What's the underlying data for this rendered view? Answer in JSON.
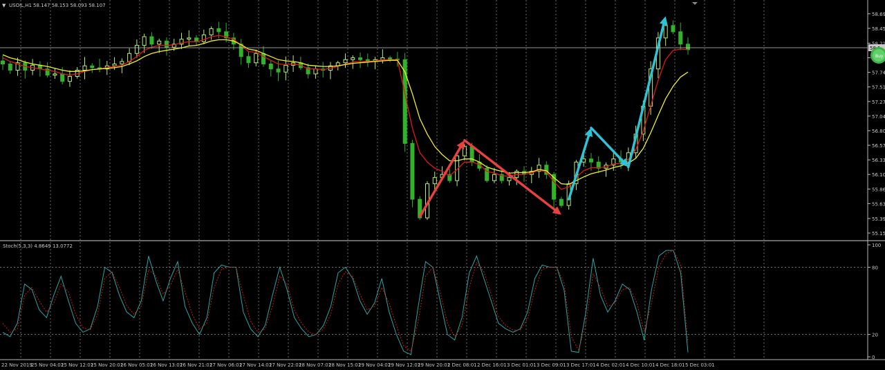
{
  "header": {
    "symbol_label": "USOIL,H1",
    "ohlc_label": "58.147 58.153 58.093 58.107",
    "scroll_marker": "▼"
  },
  "price_panel": {
    "current_price_label": "58.1",
    "buy_badge_label": "Buy"
  },
  "indicator_panel": {
    "label": "Stoch(5,3,3) 4.8649 13.0772",
    "levels": [
      80,
      20
    ],
    "scale_labels": [
      "100",
      "80",
      "20",
      "0"
    ]
  },
  "colors": {
    "background": "#000000",
    "bull_candle": "#b7f07a",
    "bear_candle": "#31b22a",
    "ma_red": "#e01818",
    "ma_yellow": "#f2ee2a",
    "stoch_main": "#2aa6a6",
    "stoch_signal": "#d01818",
    "arrow_red": "#e8413f",
    "arrow_cyan": "#2ec4d6",
    "grid": "#9a9a9a"
  },
  "chart_data": [
    {
      "type": "candlestick",
      "title": "USOIL,H1",
      "ylim": [
        55.155,
        58.8
      ],
      "y_ticks": [
        "58.690",
        "58.455",
        "58.215",
        "57.980",
        "57.745",
        "57.510",
        "57.275",
        "57.040",
        "56.805",
        "56.570",
        "56.335",
        "56.100",
        "55.865",
        "55.630",
        "55.390",
        "55.155"
      ],
      "x_tick_labels": [
        "22 Nov 2019",
        "25 Nov 04:01",
        "25 Nov 12:01",
        "25 Nov 20:01",
        "26 Nov 05:01",
        "26 Nov 13:01",
        "26 Nov 21:01",
        "27 Nov 06:01",
        "27 Nov 14:01",
        "27 Nov 22:01",
        "28 Nov 07:01",
        "28 Nov 15:01",
        "29 Nov 04:01",
        "29 Nov 12:01",
        "29 Nov 20:01",
        "2 Dec 08:01",
        "2 Dec 16:01",
        "3 Dec 01:01",
        "3 Dec 09:01",
        "3 Dec 17:01",
        "4 Dec 02:01",
        "4 Dec 10:01",
        "4 Dec 18:01",
        "5 Dec 03:01"
      ],
      "close_path": [
        57.88,
        57.78,
        57.9,
        57.78,
        57.86,
        57.8,
        57.7,
        57.72,
        57.6,
        57.68,
        57.78,
        57.85,
        57.82,
        57.8,
        57.85,
        57.88,
        57.92,
        58.05,
        58.18,
        58.32,
        58.2,
        58.25,
        58.15,
        58.2,
        58.28,
        58.3,
        58.24,
        58.35,
        58.45,
        58.4,
        58.3,
        58.2,
        58.0,
        57.9,
        58.05,
        57.88,
        57.8,
        57.75,
        57.86,
        57.9,
        57.82,
        57.72,
        57.8,
        57.78,
        57.85,
        57.9,
        57.95,
        57.98,
        57.95,
        57.92,
        57.95,
        57.98,
        57.96,
        57.95,
        56.6,
        55.7,
        55.4,
        55.95,
        56.05,
        56.1,
        56.0,
        56.4,
        56.55,
        56.3,
        56.2,
        56.0,
        56.1,
        56.0,
        56.05,
        56.15,
        56.1,
        56.15,
        56.25,
        56.1,
        55.7,
        55.6,
        55.95,
        56.3,
        56.35,
        56.3,
        56.2,
        56.25,
        56.35,
        56.3,
        56.45,
        56.75,
        57.2,
        57.8,
        58.3,
        58.5,
        58.4,
        58.2,
        58.11
      ],
      "series": [
        {
          "name": "MA red",
          "color": "#e01818",
          "values": [
            57.98,
            57.92,
            57.88,
            57.84,
            57.82,
            57.8,
            57.78,
            57.76,
            57.72,
            57.7,
            57.72,
            57.76,
            57.79,
            57.8,
            57.82,
            57.84,
            57.86,
            57.92,
            58.0,
            58.1,
            58.15,
            58.18,
            58.18,
            58.19,
            58.22,
            58.24,
            58.24,
            58.27,
            58.32,
            58.34,
            58.32,
            58.28,
            58.18,
            58.08,
            58.07,
            58.0,
            57.94,
            57.88,
            57.87,
            57.88,
            57.86,
            57.8,
            57.8,
            57.79,
            57.81,
            57.84,
            57.88,
            57.91,
            57.92,
            57.92,
            57.93,
            57.95,
            57.95,
            57.95,
            57.4,
            56.85,
            56.45,
            56.3,
            56.2,
            56.15,
            56.08,
            56.18,
            56.3,
            56.3,
            56.26,
            56.15,
            56.12,
            56.08,
            56.07,
            56.1,
            56.1,
            56.12,
            56.17,
            56.14,
            55.98,
            55.86,
            55.9,
            56.05,
            56.16,
            56.21,
            56.21,
            56.22,
            56.27,
            56.28,
            56.34,
            56.5,
            56.8,
            57.2,
            57.62,
            57.95,
            58.1,
            58.12,
            58.11
          ]
        },
        {
          "name": "MA yellow",
          "color": "#f2ee2a",
          "values": [
            58.03,
            57.98,
            57.95,
            57.91,
            57.88,
            57.86,
            57.84,
            57.81,
            57.78,
            57.76,
            57.76,
            57.77,
            57.79,
            57.8,
            57.81,
            57.82,
            57.84,
            57.88,
            57.93,
            58.0,
            58.05,
            58.08,
            58.1,
            58.12,
            58.14,
            58.17,
            58.18,
            58.21,
            58.25,
            58.27,
            58.27,
            58.25,
            58.19,
            58.12,
            58.1,
            58.05,
            58.0,
            57.95,
            57.93,
            57.92,
            57.9,
            57.86,
            57.85,
            57.84,
            57.84,
            57.85,
            57.87,
            57.89,
            57.9,
            57.91,
            57.92,
            57.93,
            57.94,
            57.94,
            57.75,
            57.4,
            57.0,
            56.75,
            56.55,
            56.42,
            56.32,
            56.32,
            56.35,
            56.35,
            56.3,
            56.22,
            56.18,
            56.15,
            56.12,
            56.13,
            56.13,
            56.14,
            56.18,
            56.16,
            56.05,
            55.95,
            55.94,
            56.0,
            56.06,
            56.11,
            56.14,
            56.17,
            56.21,
            56.24,
            56.28,
            56.36,
            56.52,
            56.77,
            57.05,
            57.32,
            57.52,
            57.67,
            57.75
          ]
        }
      ],
      "annotations": [
        {
          "type": "arrow",
          "color": "red",
          "from": {
            "x_index": 56,
            "y": 55.42
          },
          "to": {
            "x_index": 62,
            "y": 56.65
          }
        },
        {
          "type": "arrow",
          "color": "red",
          "from": {
            "x_index": 62,
            "y": 56.65
          },
          "to": {
            "x_index": 75,
            "y": 55.45
          }
        },
        {
          "type": "arrow",
          "color": "cyan",
          "from": {
            "x_index": 76,
            "y": 55.7
          },
          "to": {
            "x_index": 79,
            "y": 56.85
          }
        },
        {
          "type": "arrow",
          "color": "cyan",
          "from": {
            "x_index": 79,
            "y": 56.85
          },
          "to": {
            "x_index": 84,
            "y": 56.22
          }
        },
        {
          "type": "arrow",
          "color": "cyan",
          "from": {
            "x_index": 84,
            "y": 56.22
          },
          "to": {
            "x_index": 89,
            "y": 58.65
          }
        }
      ]
    },
    {
      "type": "line",
      "title": "Stoch(5,3,3) 4.8649 13.0772",
      "ylim": [
        0,
        100
      ],
      "y_ticks": [
        100,
        80,
        20,
        0
      ],
      "series": [
        {
          "name": "Main",
          "color": "#2aa6a6",
          "values": [
            22,
            18,
            30,
            65,
            60,
            42,
            35,
            55,
            72,
            50,
            30,
            22,
            25,
            45,
            80,
            75,
            55,
            40,
            35,
            50,
            90,
            68,
            50,
            70,
            85,
            45,
            30,
            20,
            35,
            75,
            82,
            80,
            80,
            40,
            25,
            18,
            28,
            55,
            80,
            60,
            35,
            25,
            18,
            20,
            28,
            45,
            75,
            80,
            70,
            50,
            38,
            48,
            70,
            40,
            20,
            5,
            2,
            45,
            85,
            80,
            50,
            20,
            15,
            35,
            75,
            90,
            70,
            50,
            30,
            25,
            22,
            25,
            40,
            70,
            82,
            80,
            80,
            60,
            5,
            4,
            40,
            88,
            55,
            40,
            50,
            65,
            60,
            40,
            15,
            60,
            90,
            95,
            95,
            75,
            4
          ]
        },
        {
          "name": "Signal",
          "color": "#d01818",
          "values": [
            30,
            22,
            25,
            55,
            62,
            50,
            40,
            48,
            65,
            58,
            38,
            26,
            24,
            38,
            70,
            76,
            62,
            46,
            38,
            45,
            78,
            72,
            56,
            64,
            78,
            58,
            38,
            25,
            30,
            62,
            78,
            80,
            80,
            55,
            32,
            22,
            25,
            45,
            72,
            65,
            42,
            30,
            22,
            20,
            25,
            38,
            65,
            76,
            72,
            56,
            42,
            45,
            62,
            48,
            28,
            10,
            5,
            32,
            72,
            80,
            58,
            30,
            18,
            28,
            62,
            84,
            76,
            56,
            36,
            28,
            24,
            24,
            34,
            60,
            78,
            80,
            80,
            66,
            18,
            6,
            30,
            74,
            62,
            45,
            48,
            60,
            62,
            48,
            22,
            48,
            80,
            92,
            95,
            82,
            13
          ]
        }
      ]
    }
  ]
}
